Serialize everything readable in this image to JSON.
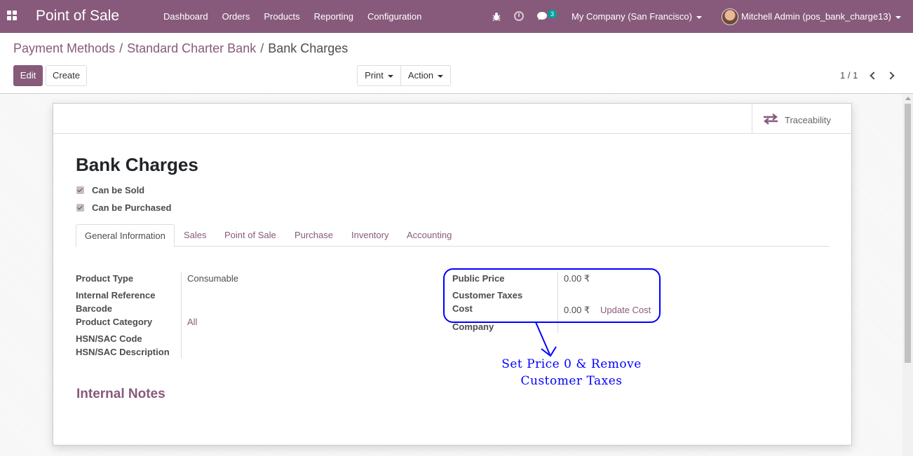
{
  "navbar": {
    "app_name": "Point of Sale",
    "menu": [
      "Dashboard",
      "Orders",
      "Products",
      "Reporting",
      "Configuration"
    ],
    "messages_count": "3",
    "company": "My Company (San Francisco)",
    "user": "Mitchell Admin (pos_bank_charge13)",
    "color": "#875a7b"
  },
  "breadcrumb": {
    "items": [
      "Payment Methods",
      "Standard Charter Bank"
    ],
    "current": "Bank Charges"
  },
  "controls": {
    "edit": "Edit",
    "create": "Create",
    "print": "Print",
    "action": "Action",
    "pager": "1 / 1"
  },
  "smart_button": {
    "label": "Traceability",
    "icon": "exchange-icon"
  },
  "record": {
    "title": "Bank Charges",
    "checkboxes": [
      {
        "label": "Can be Sold",
        "checked": true
      },
      {
        "label": "Can be Purchased",
        "checked": true
      }
    ]
  },
  "tabs": [
    "General Information",
    "Sales",
    "Point of Sale",
    "Purchase",
    "Inventory",
    "Accounting"
  ],
  "left_fields": [
    {
      "label": "Product Type",
      "value": "Consumable"
    },
    {
      "label": "Internal Reference",
      "value": ""
    },
    {
      "label": "Barcode",
      "value": ""
    },
    {
      "label": "Product Category",
      "value": "All"
    },
    {
      "label": "HSN/SAC Code",
      "value": ""
    },
    {
      "label": "HSN/SAC Description",
      "value": ""
    }
  ],
  "right_fields": [
    {
      "label": "Public Price",
      "value": "0.00 ₹"
    },
    {
      "label": "Customer Taxes",
      "value": ""
    },
    {
      "label": "Cost",
      "value": "0.00 ₹",
      "action": "Update Cost"
    },
    {
      "label": "Company",
      "value": ""
    }
  ],
  "internal_notes": "Internal Notes",
  "annotation": {
    "text": "Set  Price  0  &  Remove\nCustomer  Taxes",
    "color": "#0000ff"
  }
}
